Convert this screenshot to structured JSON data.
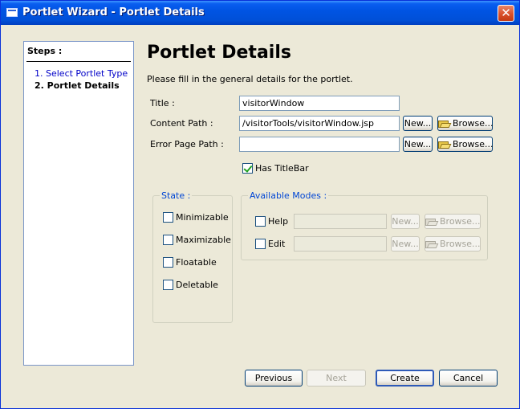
{
  "window": {
    "title": "Portlet Wizard - Portlet Details",
    "close_glyph": "✕"
  },
  "steps": {
    "header": "Steps :",
    "items": [
      {
        "label": "1. Select Portlet Type",
        "state": "link"
      },
      {
        "label": "2. Portlet Details",
        "state": "current"
      }
    ]
  },
  "main": {
    "heading": "Portlet Details",
    "description": "Please fill in the general details for the portlet.",
    "fields": {
      "title": {
        "label": "Title :",
        "value": "visitorWindow"
      },
      "content_path": {
        "label": "Content Path :",
        "value": "/visitorTools/visitorWindow.jsp"
      },
      "error_page_path": {
        "label": "Error Page Path :",
        "value": ""
      }
    },
    "new_label": "New...",
    "browse_label": "Browse...",
    "has_titlebar": {
      "label": "Has TitleBar",
      "checked": true
    }
  },
  "state_group": {
    "legend": "State :",
    "options": [
      {
        "label": "Minimizable",
        "checked": false
      },
      {
        "label": "Maximizable",
        "checked": false
      },
      {
        "label": "Floatable",
        "checked": false
      },
      {
        "label": "Deletable",
        "checked": false
      }
    ]
  },
  "modes_group": {
    "legend": "Available Modes :",
    "modes": [
      {
        "label": "Help",
        "checked": false,
        "value": "",
        "enabled": false
      },
      {
        "label": "Edit",
        "checked": false,
        "value": "",
        "enabled": false
      }
    ]
  },
  "footer": {
    "previous": "Previous",
    "next": "Next",
    "create": "Create",
    "cancel": "Cancel"
  },
  "colors": {
    "titlebar": "#0054e3",
    "window_bg": "#ece9d8",
    "legend_text": "#0046d5",
    "link": "#0000c8"
  },
  "icons": {
    "browse": "folder-open-icon",
    "checkbox_checked": "checkmark-icon"
  }
}
